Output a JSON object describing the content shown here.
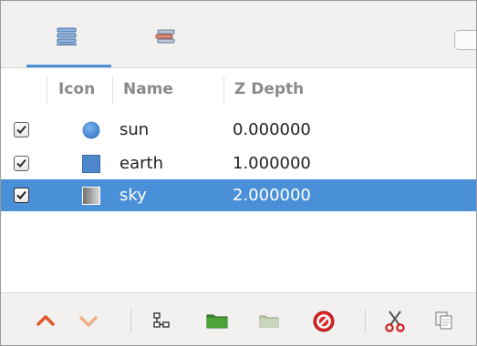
{
  "tabs": [
    {
      "icon": "layers-icon"
    },
    {
      "icon": "channels-icon"
    }
  ],
  "columns": {
    "icon": "Icon",
    "name": "Name",
    "zdepth": "Z Depth"
  },
  "rows": [
    {
      "checked": true,
      "icon": "circle-icon",
      "icon_color": "#4a90d9",
      "name": "sun",
      "zdepth": "0.000000",
      "selected": false
    },
    {
      "checked": true,
      "icon": "square-icon",
      "icon_color": "#4f87cc",
      "name": "earth",
      "zdepth": "1.000000",
      "selected": false
    },
    {
      "checked": true,
      "icon": "gradient-square-icon",
      "icon_color": "#9a9a9a",
      "name": "sky",
      "zdepth": "2.000000",
      "selected": true
    }
  ],
  "toolbar": [
    {
      "icon": "move-up-icon"
    },
    {
      "icon": "move-down-icon"
    },
    {
      "icon": "group-icon"
    },
    {
      "icon": "folder-icon"
    },
    {
      "icon": "folder-empty-icon"
    },
    {
      "icon": "delete-icon"
    },
    {
      "icon": "cut-icon"
    },
    {
      "icon": "copy-icon"
    }
  ],
  "colors": {
    "selection": "#4a90d9",
    "accent_orange": "#e2572a"
  }
}
